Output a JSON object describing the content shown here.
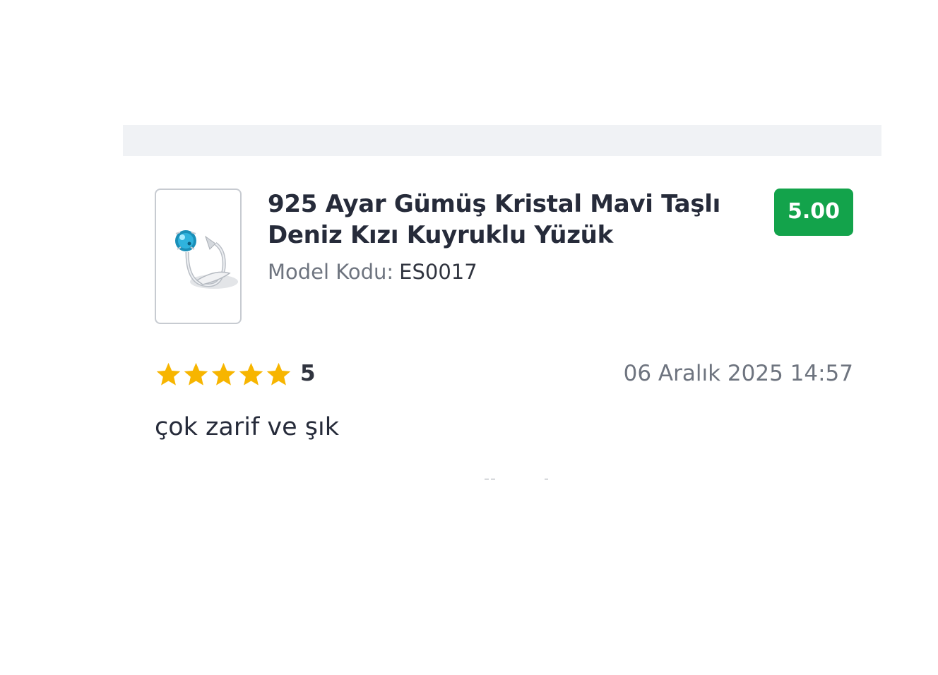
{
  "product": {
    "title": "925 Ayar Gümüş Kristal Mavi Taşlı Deniz Kızı Kuyruklu Yüzük",
    "model_label": "Model Kodu:",
    "model_value": "ES0017",
    "image_icon": "ring-product-image"
  },
  "score": {
    "value": "5.00",
    "color": "#13a34b"
  },
  "review": {
    "stars": 5,
    "max_stars": 5,
    "star_color": "#f7b500",
    "rating_text": "5",
    "date": "06 Aralık 2025 14:57",
    "comment": "çok zarif ve şık"
  }
}
